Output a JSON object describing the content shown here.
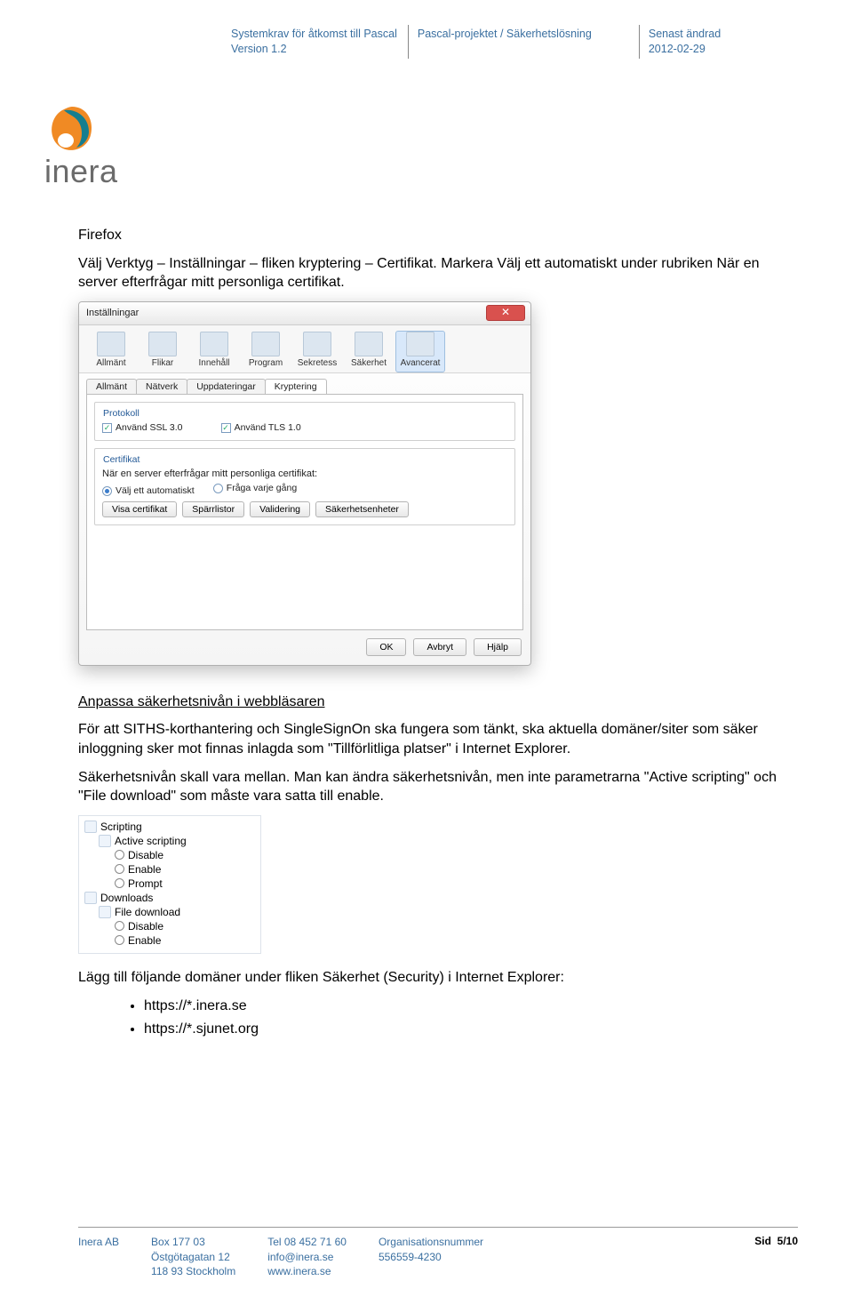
{
  "header": {
    "col1": {
      "l1": "Systemkrav för åtkomst till Pascal",
      "l2": "Version 1.2"
    },
    "col2": {
      "l1": "Pascal-projektet / Säkerhetslösning"
    },
    "col3": {
      "l1": "Senast ändrad",
      "l2": "2012-02-29"
    }
  },
  "logo_text": "inera",
  "body": {
    "h_firefox": "Firefox",
    "p_firefox": "Välj Verktyg – Inställningar – fliken kryptering – Certifikat. Markera Välj ett automatiskt under rubriken När en server efterfrågar mitt personliga certifikat.",
    "h_anpassa": "Anpassa säkerhetsnivån i webbläsaren",
    "p_anpassa1": "För att SITHS-korthantering och SingleSignOn ska fungera som tänkt, ska aktuella domäner/siter som säker inloggning sker mot finnas inlagda som \"Tillförlitliga platser\" i Internet Explorer.",
    "p_anpassa2": "Säkerhetsnivån skall vara mellan. Man kan ändra säkerhetsnivån, men inte parametrarna \"Active scripting\" och \"File download\" som måste vara satta till enable.",
    "p_lagg": "Lägg till följande domäner under fliken Säkerhet (Security) i Internet Explorer:",
    "bullets": [
      "https://*.inera.se",
      "https://*.sjunet.org"
    ]
  },
  "ff": {
    "title": "Inställningar",
    "close_glyph": "✕",
    "toolbar": [
      "Allmänt",
      "Flikar",
      "Innehåll",
      "Program",
      "Sekretess",
      "Säkerhet",
      "Avancerat"
    ],
    "subtabs": [
      "Allmänt",
      "Nätverk",
      "Uppdateringar",
      "Kryptering"
    ],
    "group_protokoll": "Protokoll",
    "chk_ssl": "Använd SSL 3.0",
    "chk_tls": "Använd TLS 1.0",
    "group_cert": "Certifikat",
    "cert_q": "När en server efterfrågar mitt personliga certifikat:",
    "r_auto": "Välj ett automatiskt",
    "r_ask": "Fråga varje gång",
    "btn_viewcert": "Visa certifikat",
    "btn_revlists": "Spärrlistor",
    "btn_valid": "Validering",
    "btn_secdev": "Säkerhetsenheter",
    "btn_ok": "OK",
    "btn_cancel": "Avbryt",
    "btn_help": "Hjälp"
  },
  "ie": {
    "scripting": "Scripting",
    "active_scripting": "Active scripting",
    "disable": "Disable",
    "enable": "Enable",
    "prompt": "Prompt",
    "downloads": "Downloads",
    "file_download": "File download"
  },
  "footer": {
    "c1": {
      "l1": "Inera AB"
    },
    "c2": {
      "l1": "Box 177 03",
      "l2": "Östgötagatan 12",
      "l3": "118 93 Stockholm"
    },
    "c3": {
      "l1": "Tel 08 452 71 60",
      "l2": "info@inera.se",
      "l3": "www.inera.se"
    },
    "c4": {
      "l1": "Organisationsnummer",
      "l2": "556559-4230"
    },
    "page_label": "Sid",
    "page": "5/10"
  }
}
